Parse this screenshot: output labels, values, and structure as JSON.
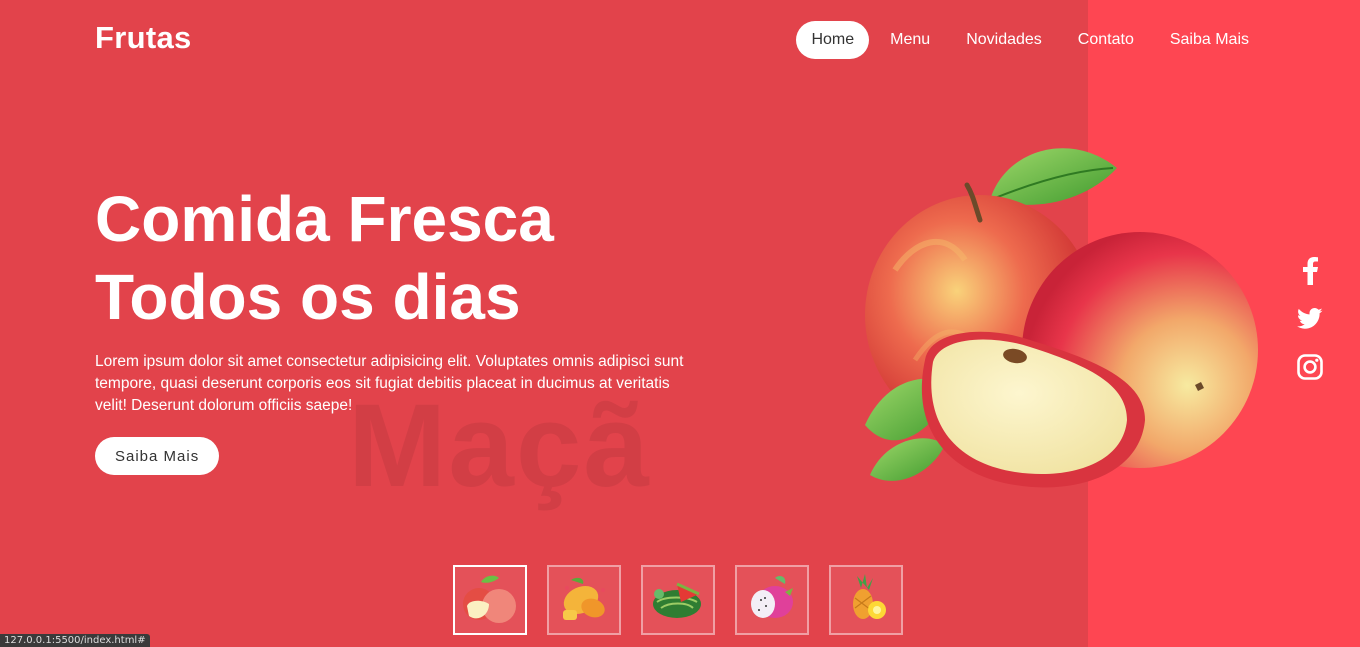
{
  "header": {
    "logo": "Frutas",
    "nav": [
      {
        "label": "Home",
        "active": true
      },
      {
        "label": "Menu",
        "active": false
      },
      {
        "label": "Novidades",
        "active": false
      },
      {
        "label": "Contato",
        "active": false
      },
      {
        "label": "Saiba Mais",
        "active": false
      }
    ]
  },
  "hero": {
    "title_line1": "Comida Fresca",
    "title_line2": "Todos os dias",
    "description": "Lorem ipsum dolor sit amet consectetur adipisicing elit. Voluptates omnis adipisci sunt tempore, quasi deserunt corporis eos sit fugiat debitis placeat in ducimus at veritatis velit! Deserunt dolorum officiis saepe!",
    "cta_label": "Saiba Mais",
    "watermark": "Maçã"
  },
  "social": {
    "icons": [
      "facebook-icon",
      "twitter-icon",
      "instagram-icon"
    ]
  },
  "thumbnails": [
    {
      "name": "apple-thumb",
      "active": true
    },
    {
      "name": "mango-thumb",
      "active": false
    },
    {
      "name": "watermelon-thumb",
      "active": false
    },
    {
      "name": "dragonfruit-thumb",
      "active": false
    },
    {
      "name": "pineapple-thumb",
      "active": false
    }
  ],
  "colors": {
    "background": "#e2434b",
    "right_band": "#fe4652",
    "text": "#ffffff"
  },
  "statusbar": {
    "url": "127.0.0.1:5500/index.html#"
  }
}
